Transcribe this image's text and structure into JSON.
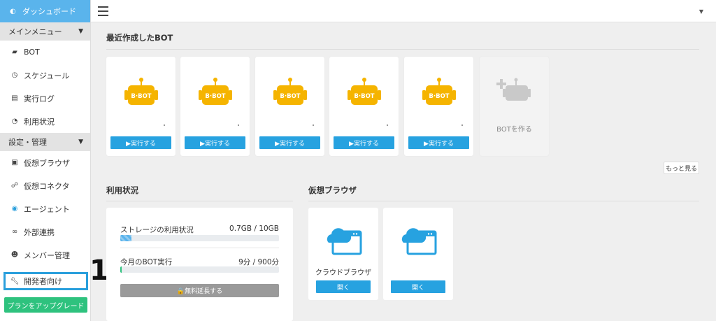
{
  "sidebar": {
    "dashboard": "ダッシュボード",
    "main_menu": "メインメニュー",
    "main_items": [
      {
        "label": "BOT"
      },
      {
        "label": "スケジュール"
      },
      {
        "label": "実行ログ"
      },
      {
        "label": "利用状況"
      }
    ],
    "settings": "設定・管理",
    "settings_items": [
      {
        "label": "仮想ブラウザ"
      },
      {
        "label": "仮想コネクタ"
      },
      {
        "label": "エージェント"
      },
      {
        "label": "外部連携"
      },
      {
        "label": "メンバー管理"
      }
    ],
    "developer": "開発者向け",
    "upgrade": "プランをアップグレード"
  },
  "annotation": "1",
  "recent": {
    "title": "最近作成したBOT",
    "bots": [
      {
        "badge": "B·BOT",
        "run": "▶実行する"
      },
      {
        "badge": "B·BOT",
        "run": "▶実行する"
      },
      {
        "badge": "B·BOT",
        "run": "▶実行する"
      },
      {
        "badge": "B·BOT",
        "run": "▶実行する"
      },
      {
        "badge": "B·BOT",
        "run": "▶実行する"
      }
    ],
    "create": "BOTを作る",
    "more": "もっと見る"
  },
  "usage": {
    "title": "利用状況",
    "storage_label": "ストレージの利用状況",
    "storage_value": "0.7GB / 10GB",
    "storage_fraction": 0.07,
    "bot_label": "今月のBOT実行",
    "bot_value": "9分 / 900分",
    "bot_fraction": 0.01,
    "extend": "🔒無料延長する"
  },
  "browsers": {
    "title": "仮想ブラウザ",
    "items": [
      {
        "name": "クラウドブラウザ",
        "open": "開く"
      },
      {
        "name": "",
        "open": "開く"
      }
    ]
  },
  "colors": {
    "accent": "#5ab4ec",
    "button": "#27a2e0",
    "bot_yellow": "#f5b400",
    "upgrade_green": "#2ec27e",
    "highlight": "#2a9fdc"
  }
}
